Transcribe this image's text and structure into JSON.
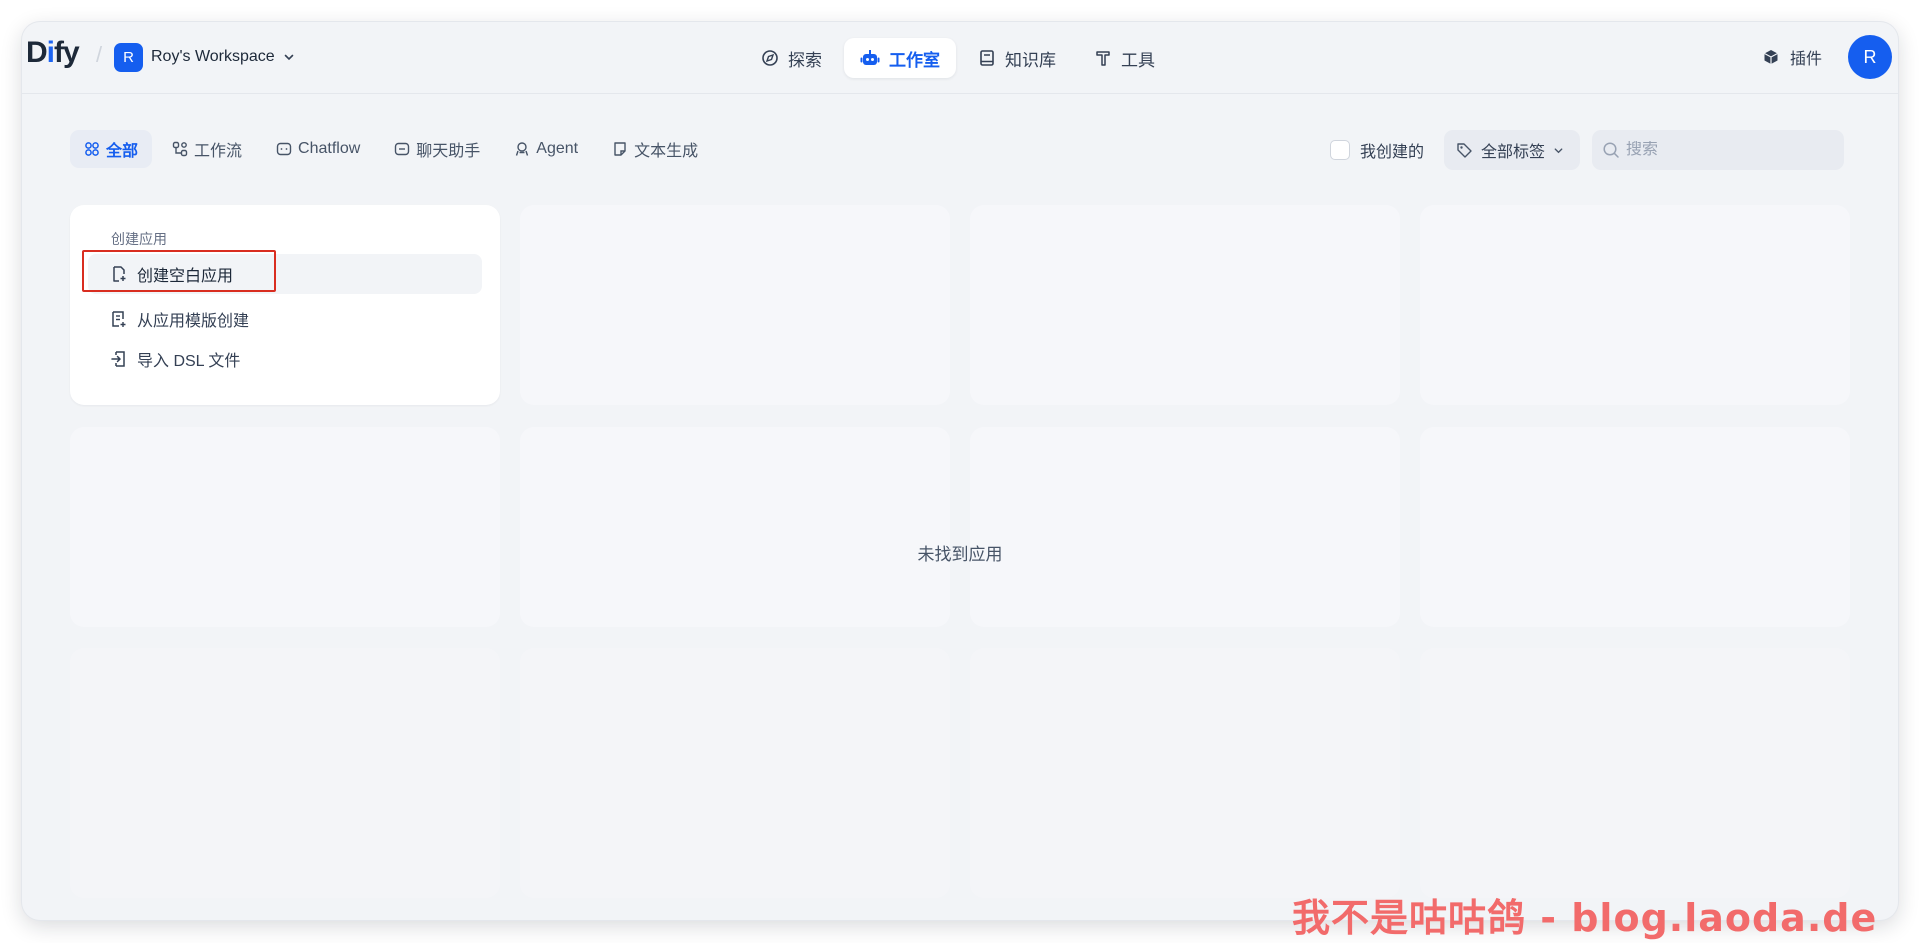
{
  "app": {
    "logo": "Dify"
  },
  "workspace": {
    "avatar_letter": "R",
    "name": "Roy's Workspace"
  },
  "nav": {
    "items": [
      {
        "label": "探索",
        "icon": "compass-icon"
      },
      {
        "label": "工作室",
        "icon": "robot-icon",
        "active": true
      },
      {
        "label": "知识库",
        "icon": "book-icon"
      },
      {
        "label": "工具",
        "icon": "hammer-icon"
      }
    ]
  },
  "plugins": {
    "label": "插件",
    "icon": "cube-icon"
  },
  "user": {
    "avatar_letter": "R"
  },
  "filters": {
    "tabs": [
      {
        "label": "全部",
        "icon": "grid-icon",
        "active": true
      },
      {
        "label": "工作流",
        "icon": "workflow-icon"
      },
      {
        "label": "Chatflow",
        "icon": "chat-bubble-icon"
      },
      {
        "label": "聊天助手",
        "icon": "chat-bot-icon"
      },
      {
        "label": "Agent",
        "icon": "agent-icon"
      },
      {
        "label": "文本生成",
        "icon": "document-icon"
      }
    ],
    "mine_label": "我创建的",
    "mine_checked": false,
    "tags_label": "全部标签",
    "search_placeholder": "搜索"
  },
  "create_app": {
    "title": "创建应用",
    "items": [
      {
        "label": "创建空白应用",
        "icon": "new-file-icon"
      },
      {
        "label": "从应用模版创建",
        "icon": "template-icon"
      },
      {
        "label": "导入 DSL 文件",
        "icon": "import-icon"
      }
    ]
  },
  "empty_state": "未找到应用",
  "watermark": "我不是咕咕鸽 - blog.laoda.de",
  "colors": {
    "accent": "#155eef",
    "highlight": "#d92d20",
    "watermark": "#f26b6b"
  }
}
